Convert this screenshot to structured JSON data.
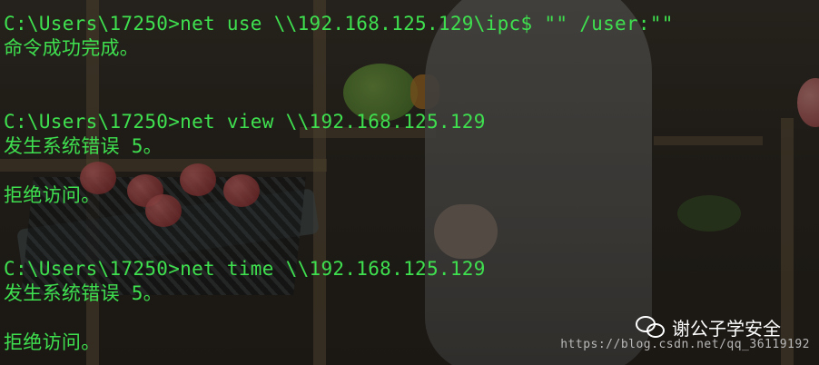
{
  "terminal": {
    "color": "#3fe04f",
    "lines": [
      "C:\\Users\\17250>net use \\\\192.168.125.129\\ipc$ \"\" /user:\"\"",
      "命令成功完成。",
      "C:\\Users\\17250>net view \\\\192.168.125.129",
      "发生系统错误 5。",
      "拒绝访问。",
      "C:\\Users\\17250>net time \\\\192.168.125.129",
      "发生系统错误 5。",
      "拒绝访问。"
    ]
  },
  "watermark": {
    "icon": "wechat-icon",
    "brand": "谢公子学安全",
    "url": "https://blog.csdn.net/qq_36119192"
  }
}
